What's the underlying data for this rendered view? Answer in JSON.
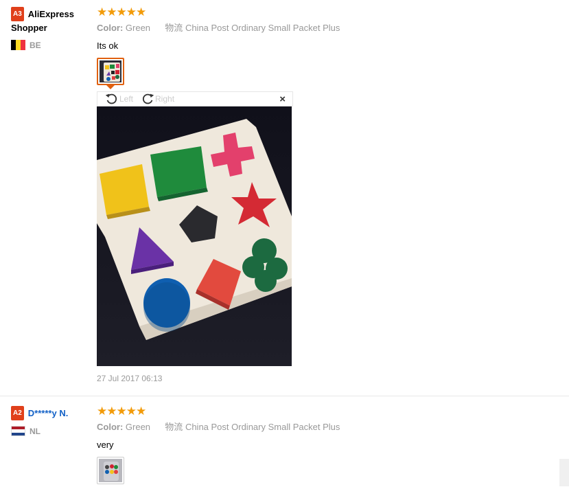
{
  "reviews": [
    {
      "badge": "A3",
      "name": "AliExpress Shopper",
      "country": "BE",
      "stars": "★★★★★",
      "color_label": "Color:",
      "color_value": "Green",
      "shipping_label": "物流",
      "shipping_value": "China Post Ordinary Small Packet Plus",
      "text": "Its ok",
      "date": "27 Jul 2017 06:13"
    },
    {
      "badge": "A2",
      "name": "D*****y N.",
      "country": "NL",
      "stars": "★★★★★",
      "color_label": "Color:",
      "color_value": "Green",
      "shipping_label": "物流",
      "shipping_value": "China Post Ordinary Small Packet Plus",
      "text": "very"
    }
  ],
  "viewer": {
    "rotate_left": "Left",
    "rotate_right": "Right",
    "close": "×"
  },
  "colors": {
    "star": "#f29b0a",
    "badge": "#e0401b",
    "link": "#1160c6",
    "thumb_active_border": "#e06010"
  }
}
